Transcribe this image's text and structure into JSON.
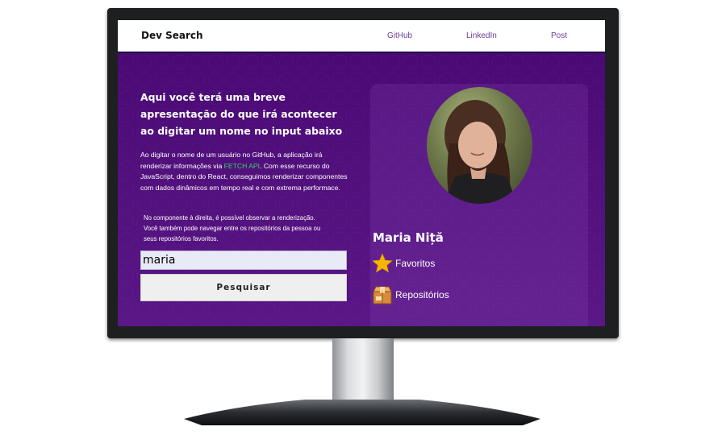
{
  "navbar": {
    "brand": "Dev Search",
    "links": [
      "GitHub",
      "LinkedIn",
      "Post"
    ]
  },
  "hero": {
    "headline": "Aqui você terá uma breve apresentação do que irá acontecer ao digitar um nome no input abaixo",
    "para1_before": "Ao digitar o nome de um usuário no GitHub, a aplicação irá renderizar informações via ",
    "para1_highlight": "FETCH API",
    "para1_after": ". Com esse recurso do JavaScript, dentro do React, conseguimos renderizar componentes com dados dinâmicos em tempo real e com extrema performace.",
    "para2": "No componente à direita, é possível observar a renderização. Você também pode navegar entre os repositórios da pessoa ou seus repositórios favoritos.",
    "search": {
      "value": "maria",
      "button_label": "Pesquisar"
    }
  },
  "profile": {
    "name": "Maria Niță",
    "links": [
      {
        "label": "Favoritos",
        "icon": "star-icon"
      },
      {
        "label": "Repositórios",
        "icon": "box-icon"
      }
    ]
  },
  "colors": {
    "hero_bg": "#541480",
    "highlight": "#38d46a",
    "nav_link": "#6a3d98",
    "star": "#f7b500"
  }
}
